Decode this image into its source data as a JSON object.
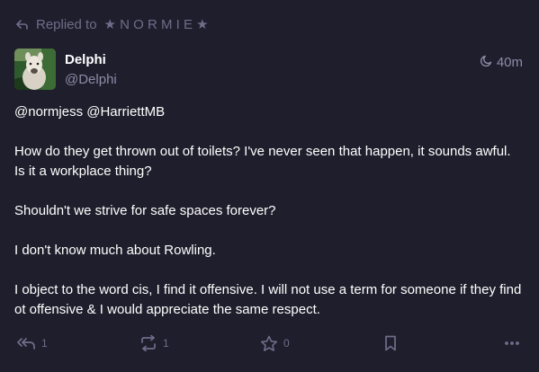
{
  "reply_context": {
    "prefix": "Replied to",
    "target": "★ N O R M I E ★",
    "icon": "reply-arrow-icon"
  },
  "author": {
    "display_name": "Delphi",
    "handle": "@Delphi",
    "avatar_icon": "alpaca-avatar"
  },
  "timestamp": {
    "icon": "moon-icon",
    "label": "40m"
  },
  "content": {
    "mentions": "@normjess @HarriettMB",
    "paragraphs": [
      "How do they get thrown out of toilets? I've never seen that happen, it sounds awful. Is it a workplace thing?",
      "Shouldn't we strive for safe spaces forever?",
      "I don't know much about Rowling.",
      "I object to the word cis, I find it offensive. I will not use a term for someone if they find ot offensive & I would appreciate the same respect."
    ]
  },
  "actions": {
    "reply": {
      "icon": "reply-all-icon",
      "count": "1"
    },
    "boost": {
      "icon": "boost-icon",
      "count": "1"
    },
    "favourite": {
      "icon": "star-icon",
      "count": "0"
    },
    "bookmark": {
      "icon": "bookmark-icon"
    },
    "more": {
      "icon": "more-icon"
    }
  },
  "colors": {
    "background": "#1f1e2c",
    "muted": "#6f6d8a",
    "secondary_text": "#8e8ca8",
    "primary_text": "#ffffff"
  }
}
